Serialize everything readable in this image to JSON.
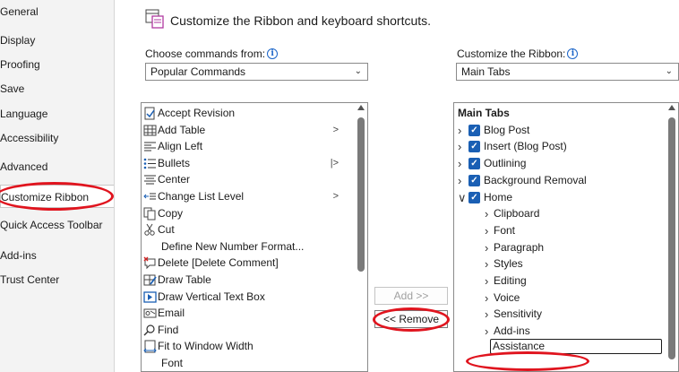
{
  "nav": {
    "items": [
      {
        "label": "General"
      },
      {
        "label": "Display"
      },
      {
        "label": "Proofing"
      },
      {
        "label": "Save"
      },
      {
        "label": "Language"
      },
      {
        "label": "Accessibility"
      },
      {
        "label": "Advanced"
      },
      {
        "label": "Customize Ribbon",
        "selected": true
      },
      {
        "label": "Quick Access Toolbar"
      },
      {
        "label": "Add-ins"
      },
      {
        "label": "Trust Center"
      }
    ]
  },
  "header": {
    "title": "Customize the Ribbon and keyboard shortcuts.",
    "icon": "customize-ribbon-icon"
  },
  "left": {
    "label": "Choose commands from:",
    "dropdown_value": "Popular Commands",
    "commands": [
      {
        "label": "Accept Revision",
        "icon": "accept-revision-icon"
      },
      {
        "label": "Add Table",
        "icon": "table-icon",
        "submenu": ">"
      },
      {
        "label": "Align Left",
        "icon": "align-left-icon"
      },
      {
        "label": "Bullets",
        "icon": "bullets-icon",
        "submenu": "|>"
      },
      {
        "label": "Center",
        "icon": "align-center-icon"
      },
      {
        "label": "Change List Level",
        "icon": "list-level-icon",
        "submenu": ">"
      },
      {
        "label": "Copy",
        "icon": "copy-icon"
      },
      {
        "label": "Cut",
        "icon": "scissors-icon"
      },
      {
        "label": "Define New Number Format...",
        "icon": ""
      },
      {
        "label": "Delete [Delete Comment]",
        "icon": "delete-comment-icon"
      },
      {
        "label": "Draw Table",
        "icon": "draw-table-icon"
      },
      {
        "label": "Draw Vertical Text Box",
        "icon": "text-box-icon"
      },
      {
        "label": "Email",
        "icon": "email-icon"
      },
      {
        "label": "Find",
        "icon": "find-icon"
      },
      {
        "label": "Fit to Window Width",
        "icon": "fit-width-icon"
      },
      {
        "label": "Font",
        "icon": ""
      }
    ]
  },
  "buttons": {
    "add": "Add >>",
    "remove": "<< Remove"
  },
  "right": {
    "label": "Customize the Ribbon:",
    "dropdown_value": "Main Tabs",
    "tree": [
      {
        "label": "Main Tabs",
        "bold": true
      },
      {
        "label": "Blog Post",
        "checked": true,
        "expanded": false
      },
      {
        "label": "Insert (Blog Post)",
        "checked": true,
        "expanded": false
      },
      {
        "label": "Outlining",
        "checked": true,
        "expanded": false
      },
      {
        "label": "Background Removal",
        "checked": true,
        "expanded": false
      },
      {
        "label": "Home",
        "checked": true,
        "expanded": true
      },
      {
        "label": "Clipboard",
        "child": true
      },
      {
        "label": "Font",
        "child": true
      },
      {
        "label": "Paragraph",
        "child": true
      },
      {
        "label": "Styles",
        "child": true
      },
      {
        "label": "Editing",
        "child": true
      },
      {
        "label": "Voice",
        "child": true
      },
      {
        "label": "Sensitivity",
        "child": true
      },
      {
        "label": "Add-ins",
        "child": true
      },
      {
        "label": "Assistance",
        "child": true,
        "selected": true
      }
    ]
  },
  "colors": {
    "accent": "#1a5fb4",
    "annotation": "#e0141e"
  }
}
